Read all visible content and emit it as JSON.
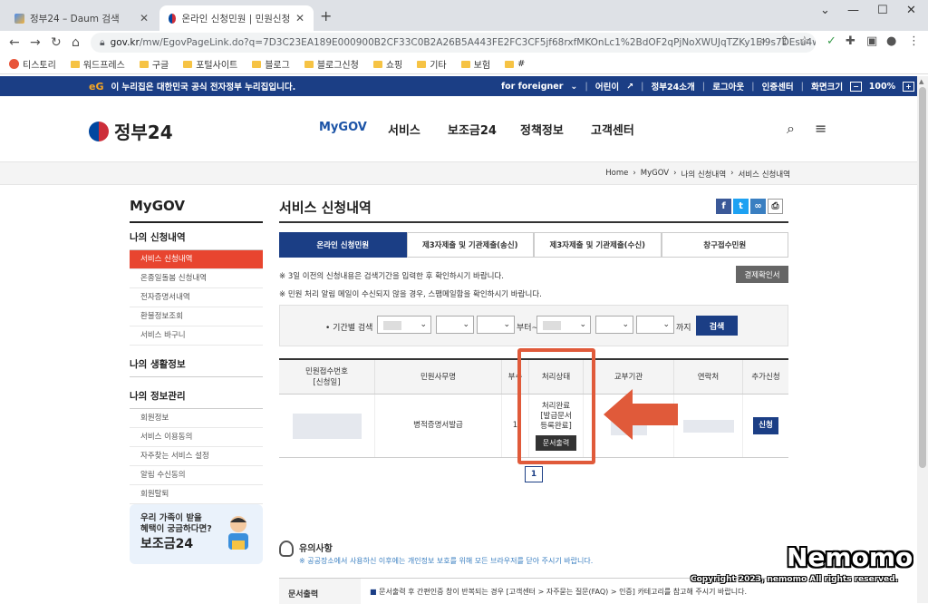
{
  "browser": {
    "tabs": [
      {
        "title": "정부24 – Daum 검색",
        "active": false
      },
      {
        "title": "온라인 신청민원 | 민원신청 내역 ...",
        "active": true
      }
    ],
    "new_tab_label": "+",
    "url_domain": "gov.kr",
    "url_path": "/mw/EgovPageLink.do?q=7D3C23EA189E000900B2CF33C0B2A26B5A443FE2FC3CF5jf68rxfMKOnLc1%2BdOF2qPjNoXWUJqTZKy1El9s7DEsu4w0%2BN...",
    "bookmarks": [
      "티스토리",
      "워드프레스",
      "구글",
      "포털사이트",
      "블로그",
      "블로그신청",
      "쇼핑",
      "기타",
      "보험",
      "#"
    ]
  },
  "gov": {
    "top_notice": "이 누리집은 대한민국 공식 전자정부 누리집입니다.",
    "top_links": [
      "for foreigner",
      "어린이",
      "정부24소개",
      "로그아웃",
      "인증센터",
      "화면크기",
      "100%"
    ],
    "logo_text": "정부24",
    "gnb": [
      "MyGOV",
      "서비스",
      "보조금24",
      "정책정보",
      "고객센터"
    ],
    "breadcrumb": [
      "Home",
      "MyGOV",
      "나의 신청내역",
      "서비스 신청내역"
    ]
  },
  "sidebar": {
    "title": "MyGOV",
    "section1": "나의 신청내역",
    "items1": [
      "서비스 신청내역",
      "온종일돌봄 신청내역",
      "전자증명서내역",
      "환불정보조회",
      "서비스 바구니"
    ],
    "section2": "나의 생활정보",
    "section3": "나의 정보관리",
    "items3": [
      "회원정보",
      "서비스 이용동의",
      "자주찾는 서비스 설정",
      "알림 수신동의",
      "회원탈퇴"
    ],
    "banner_line1": "우리 가족이 받을",
    "banner_line2": "혜택이 궁금하다면?",
    "banner_big": "보조금24"
  },
  "content": {
    "title": "서비스 신청내역",
    "tabs": [
      "온라인 신청민원",
      "제3자제출 및 기관제출(송신)",
      "제3자제출 및 기관제출(수신)",
      "창구접수민원"
    ],
    "note1": "※ 3일 이전의 신청내용은 검색기간을 입력한 후 확인하시기 바랍니다.",
    "note2": "※ 민원 처리 알림 메일이 수신되지 않을 경우, 스팸메일함을 확인하시기 바랍니다.",
    "btn_payment": "결제확인서",
    "search_label": "• 기간별 검색",
    "from_label": "부터~",
    "to_label": "까지",
    "search_btn": "검색",
    "table_headers": [
      "민원접수번호\n[신청일]",
      "민원사무명",
      "부수",
      "처리상태",
      "교부기관",
      "연락처",
      "추가신청"
    ],
    "row": {
      "service_name": "병적증명서발급",
      "count": "1",
      "status": "처리완료\n[발급문서\n등록완료]",
      "print_btn": "문서출력",
      "apply_btn": "신청"
    },
    "page": "1",
    "notice_title": "유의사항",
    "notice_sub": "※ 공공장소에서 사용하신 이후에는 개인정보 보호를 위해 모든 브라우저를 닫아 주시기 바랍니다.",
    "doc_key": "문서출력",
    "doc_value": "문서출력 후 간편인증 창이 반복되는 경우 [고객센터 > 자주묻는 질문(FAQ) > 인증] 카테고리를 참고해 주시기 바랍니다."
  },
  "watermark": "Nemomo",
  "copyright": "Copyright 2023, nemomo All rights reserved.",
  "colors": {
    "accent": "#1b3e85",
    "active_menu": "#e8452f",
    "highlight": "#e05a3a"
  }
}
